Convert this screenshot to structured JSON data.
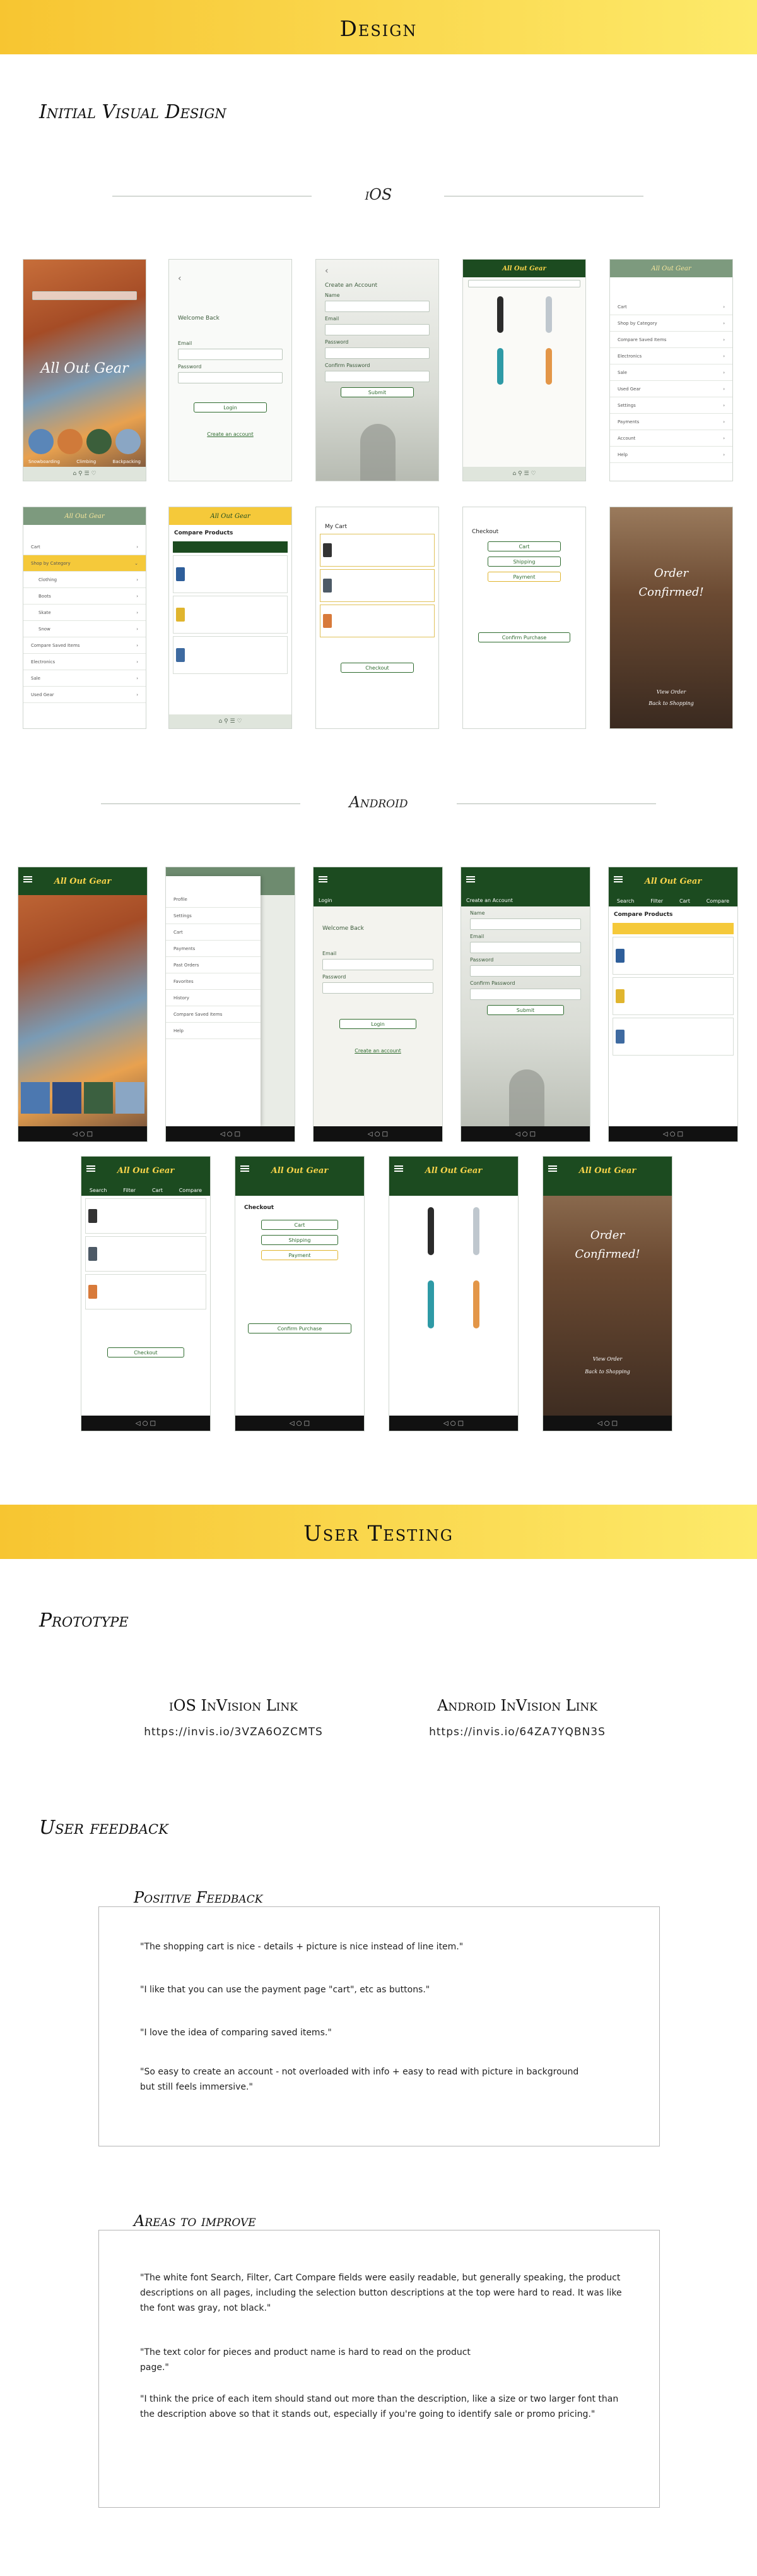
{
  "design_banner": "Design",
  "initial_visual": "Initial Visual Design",
  "ios_label": "iOS",
  "android_label": "Android",
  "app_name": "All Out Gear",
  "screens": {
    "welcome_back": "Welcome Back",
    "email": "Email",
    "password": "Password",
    "login": "Login",
    "create_account_link": "Create an account",
    "create_account_title": "Create an Account",
    "name": "Name",
    "confirm_password": "Confirm Password",
    "submit": "Submit",
    "compare_products": "Compare Products",
    "my_cart": "My Cart",
    "checkout": "Checkout",
    "checkout_btn": "Checkout",
    "cart": "Cart",
    "shipping": "Shipping",
    "payment": "Payment",
    "confirm_purchase": "Confirm Purchase",
    "order_confirmed": "Order Confirmed!",
    "view_order": "View Order",
    "back_to_shopping": "Back to Shopping",
    "categories": [
      "Snowboarding",
      "Climbing",
      "Backpacking"
    ],
    "ios_menu": [
      "Cart",
      "Shop by Category",
      "Compare Saved Items",
      "Electronics",
      "Sale",
      "Used Gear",
      "Settings",
      "Payments",
      "Account",
      "Help"
    ],
    "ios_menu2": [
      "Cart",
      "Shop by Category",
      "Clothing",
      "Boots",
      "Skate",
      "Snow",
      "Compare Saved Items",
      "Electronics",
      "Sale",
      "Used Gear"
    ],
    "android_menu": [
      "Profile",
      "Settings",
      "Cart",
      "Payments",
      "Past Orders",
      "Favorites",
      "History",
      "Compare Saved Items",
      "Help"
    ],
    "tabs": [
      "Search",
      "Filter",
      "Cart",
      "Compare"
    ]
  },
  "user_testing_banner": "User Testing",
  "prototype_heading": "Prototype",
  "ios_link_title": "iOS InVision Link",
  "ios_link_url": "https://invis.io/3VZA6OZCMTS",
  "android_link_title": "Android InVision Link",
  "android_link_url": "https://invis.io/64ZA7YQBN3S",
  "user_feedback_heading": "User feedback",
  "positive_title": "Positive Feedback",
  "positive_items": [
    "\"The shopping cart is nice - details + picture is nice instead of line item.\"",
    "\"I like that you can use the payment page \"cart\", etc as buttons.\"",
    "\"I love the idea of comparing saved items.\"",
    "\"So easy to create an account - not overloaded with info + easy to read with picture in background but still feels immersive.\""
  ],
  "improve_title": "Areas to improve",
  "improve_items": [
    "\"The white font Search, Filter, Cart Compare fields were easily readable, but generally speaking, the product descriptions on all pages, including the selection button descriptions at the top were hard to read. It was like the font was gray, not black.\"",
    "\"The text color for pieces and product name is hard to read on the product page.\"",
    "\"I think the price of each item should stand out more than the description, like a size or two larger font than the description above so that it stands out, especially if you're going to identify sale or promo pricing.\""
  ]
}
